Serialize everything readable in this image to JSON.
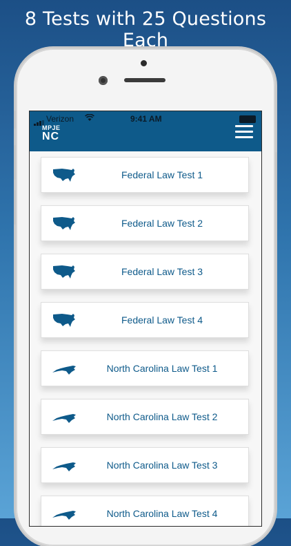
{
  "headline": "8 Tests with 25 Questions Each",
  "status_bar": {
    "carrier": "Verizon",
    "time": "9:41 AM"
  },
  "header": {
    "logo_top": "MPJE",
    "logo_bottom": "NC"
  },
  "tests": [
    {
      "label": "Federal Law Test 1",
      "icon": "usa-map-icon"
    },
    {
      "label": "Federal Law Test 2",
      "icon": "usa-map-icon"
    },
    {
      "label": "Federal Law Test 3",
      "icon": "usa-map-icon"
    },
    {
      "label": "Federal Law Test 4",
      "icon": "usa-map-icon"
    },
    {
      "label": "North Carolina Law Test 1",
      "icon": "nc-map-icon"
    },
    {
      "label": "North Carolina Law Test 2",
      "icon": "nc-map-icon"
    },
    {
      "label": "North Carolina Law Test 3",
      "icon": "nc-map-icon"
    },
    {
      "label": "North Carolina Law Test 4",
      "icon": "nc-map-icon"
    }
  ],
  "colors": {
    "brand": "#0e5a8a",
    "background_top": "#1c4f86",
    "background_bottom": "#5aa3d6"
  }
}
